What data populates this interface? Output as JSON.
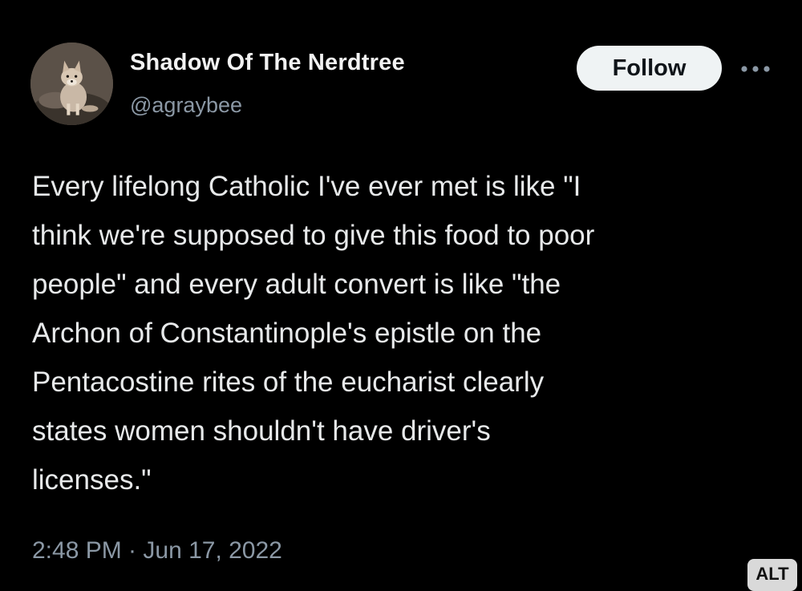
{
  "author": {
    "display_name": "Shadow Of The Nerdtree",
    "handle": "@agraybee",
    "avatar_icon": "fox-photo-avatar"
  },
  "actions": {
    "follow_label": "Follow",
    "more_icon": "ellipsis-icon"
  },
  "tweet": {
    "text": "Every lifelong Catholic I've ever met is like \"I\nthink we're supposed to give this food to poor\npeople\" and every adult convert is like \"the\nArchon of Constantinople's epistle on the\nPentacostine rites of the eucharist clearly\nstates women shouldn't have driver's\nlicenses.\"",
    "timestamp": "2:48 PM · Jun 17, 2022"
  },
  "badge": {
    "alt_label": "ALT"
  },
  "colors": {
    "background": "#000000",
    "text_primary": "#e7e9ea",
    "text_secondary": "#8b98a5",
    "follow_bg": "#eff3f4",
    "follow_text": "#0f1419"
  }
}
